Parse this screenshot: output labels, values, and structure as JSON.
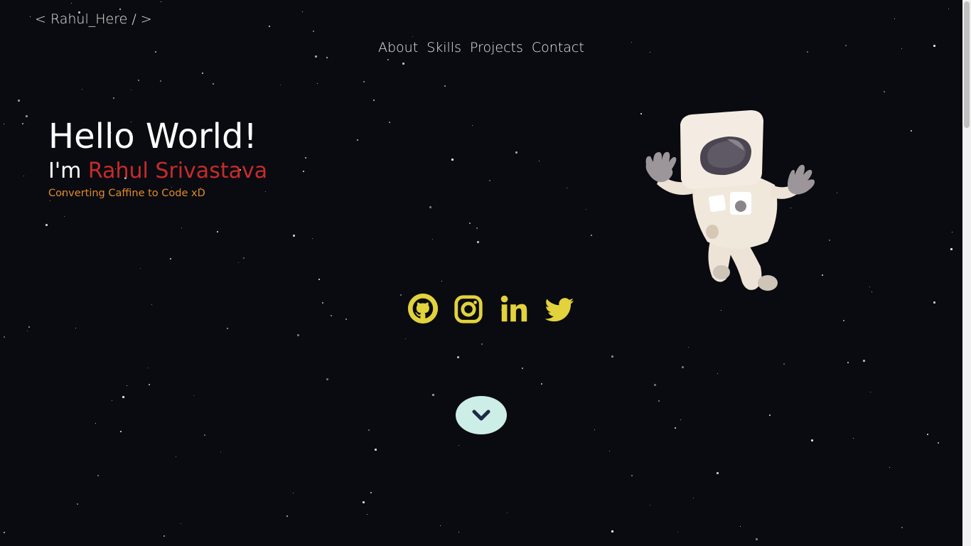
{
  "header": {
    "logo_text": "< Rahul_Here / >",
    "nav": [
      {
        "label": "About"
      },
      {
        "label": "Skills"
      },
      {
        "label": "Projects"
      },
      {
        "label": "Contact"
      }
    ]
  },
  "hero": {
    "greeting": "Hello World!",
    "intro_prefix": "I'm",
    "name": "Rahul Srivastava",
    "tagline": "Converting Caffine to Code xD"
  },
  "social": [
    {
      "icon": "github-icon"
    },
    {
      "icon": "instagram-icon"
    },
    {
      "icon": "linkedin-icon"
    },
    {
      "icon": "twitter-icon"
    }
  ],
  "colors": {
    "background": "#0a0b10",
    "name_accent": "#c62b2b",
    "tagline": "#e08a2a",
    "social_icons": "#e2d23c",
    "scroll_button": "#cdeee6",
    "scroll_arrow": "#1d2a44"
  },
  "scroll_button": {
    "icon": "chevron-down-icon"
  },
  "illustration": {
    "icon": "astronaut-illustration"
  }
}
